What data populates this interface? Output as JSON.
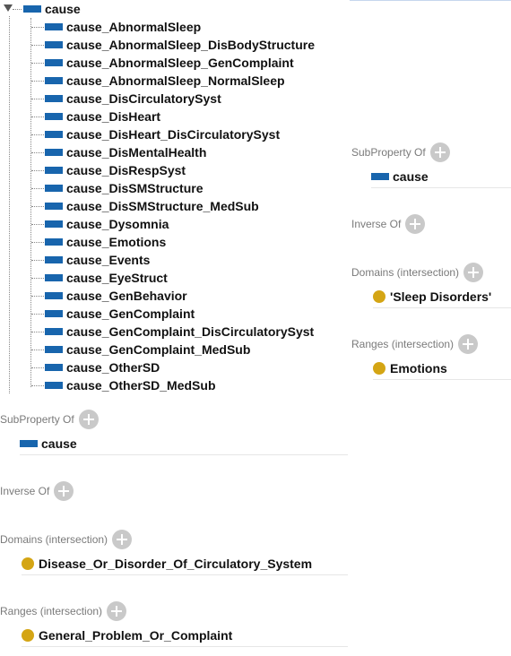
{
  "tree": {
    "root": "cause",
    "children": [
      "cause_AbnormalSleep",
      "cause_AbnormalSleep_DisBodyStructure",
      "cause_AbnormalSleep_GenComplaint",
      "cause_AbnormalSleep_NormalSleep",
      "cause_DisCirculatorySyst",
      "cause_DisHeart",
      "cause_DisHeart_DisCirculatorySyst",
      "cause_DisMentalHealth",
      "cause_DisRespSyst",
      "cause_DisSMStructure",
      "cause_DisSMStructure_MedSub",
      "cause_Dysomnia",
      "cause_Emotions",
      "cause_Events",
      "cause_EyeStruct",
      "cause_GenBehavior",
      "cause_GenComplaint",
      "cause_GenComplaint_DisCirculatorySyst",
      "cause_GenComplaint_MedSub",
      "cause_OtherSD",
      "cause_OtherSD_MedSub"
    ]
  },
  "right_panel": {
    "subproperty_title": "SubProperty Of",
    "subproperty_value": "cause",
    "inverse_title": "Inverse Of",
    "domains_title": "Domains (intersection)",
    "domains_value": "'Sleep Disorders'",
    "ranges_title": "Ranges (intersection)",
    "ranges_value": "Emotions"
  },
  "bottom_panel": {
    "subproperty_title": "SubProperty Of",
    "subproperty_value": "cause",
    "inverse_title": "Inverse Of",
    "domains_title": "Domains (intersection)",
    "domains_value": "Disease_Or_Disorder_Of_Circulatory_System",
    "ranges_title": "Ranges (intersection)",
    "ranges_value": "General_Problem_Or_Complaint"
  },
  "colors": {
    "property_icon": "#1865ad",
    "class_icon": "#d4a514",
    "section_title": "#7a7a7a",
    "add_button": "#c9c9c9"
  },
  "icons": {
    "property": "property-icon",
    "class": "class-icon",
    "add": "add-icon",
    "expand": "expand-triangle-icon"
  }
}
